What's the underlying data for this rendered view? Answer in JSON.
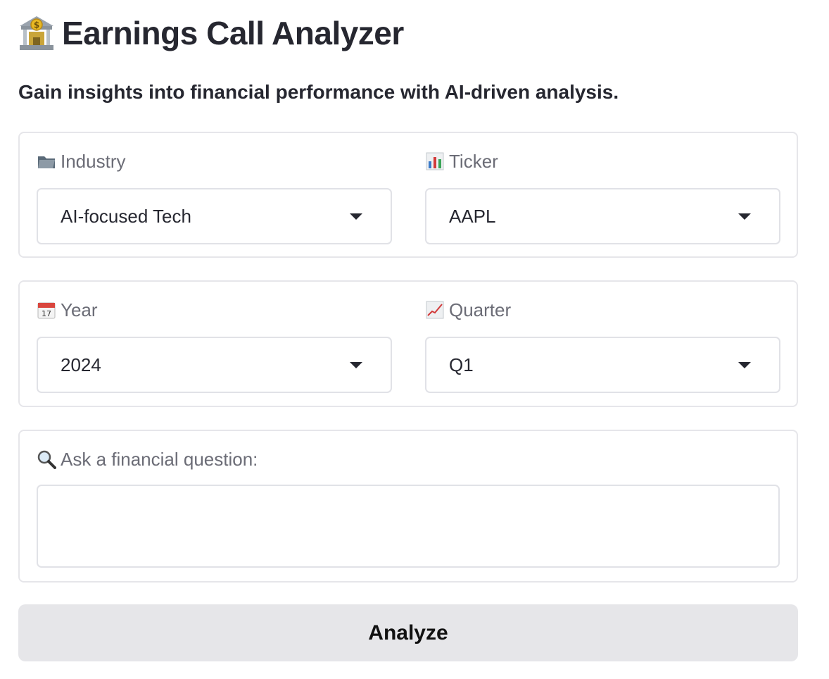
{
  "header": {
    "icon": "bank-icon",
    "title": "Earnings Call Analyzer",
    "subtitle": "Gain insights into financial performance with AI-driven analysis."
  },
  "filters": {
    "industry": {
      "icon": "folder-icon",
      "label": "Industry",
      "value": "AI-focused Tech"
    },
    "ticker": {
      "icon": "bar-chart-icon",
      "label": "Ticker",
      "value": "AAPL"
    },
    "year": {
      "icon": "calendar-icon",
      "label": "Year",
      "value": "2024"
    },
    "quarter": {
      "icon": "chart-increasing-icon",
      "label": "Quarter",
      "value": "Q1"
    }
  },
  "question": {
    "icon": "magnifier-icon",
    "label": "Ask a financial question:",
    "value": ""
  },
  "actions": {
    "analyze_label": "Analyze"
  },
  "colors": {
    "text": "#262730",
    "label": "#6b6c76",
    "border": "#e6e6ea",
    "button_bg": "#e6e6e9"
  }
}
